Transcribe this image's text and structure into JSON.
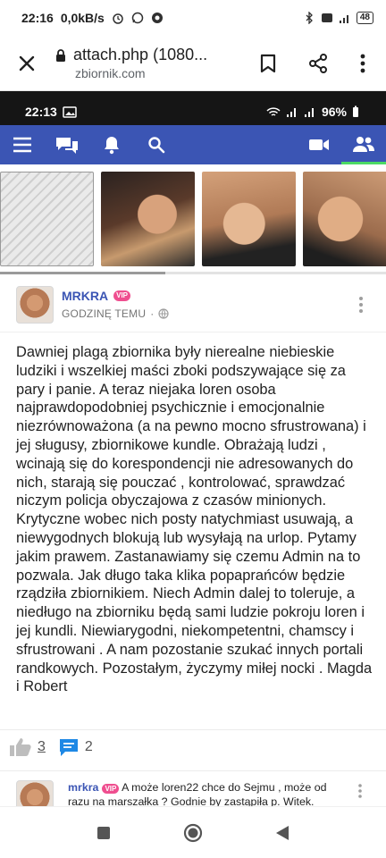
{
  "status_bar": {
    "time": "22:16",
    "speed": "0,0kB/s",
    "battery": "48"
  },
  "chrome": {
    "title": "attach.php (1080...",
    "domain": "zbiornik.com"
  },
  "inner_status": {
    "time": "22:13",
    "battery": "96%"
  },
  "post": {
    "author": "MRKRA",
    "vip_badge": "VIP",
    "time": "GODZINĘ TEMU",
    "separator": "·",
    "body": "Dawniej plagą zbiornika były nierealne niebieskie ludziki i wszelkiej maści zboki podszywające się za pary i panie. A teraz niejaka loren osoba najprawdopodobniej psychicznie i emocjonalnie niezrównoważona (a na pewno mocno sfrustrowana) i jej sługusy, zbiornikowe kundle. Obrażają ludzi , wcinają się do korespondencji nie adresowanych do nich, starają się pouczać , kontrolować, sprawdzać niczym policja obyczajowa z czasów minionych. Krytyczne wobec nich posty natychmiast usuwają, a niewygodnych blokują lub wysyłają na urlop. Pytamy jakim prawem. Zastanawiamy się czemu Admin na to pozwala. Jak długo taka klika popaprańców będzie rządziła zbiornikiem. Niech Admin dalej to toleruje, a niedługo na zbiorniku będą sami ludzie pokroju loren i jej kundli. Niewiarygodni, niekompetentni, chamscy i sfrustrowani . A nam pozostanie szukać innych portali randkowych. Pozostałym, życzymy miłej nocki . Magda i Robert",
    "likes": "3",
    "comments": "2"
  },
  "comment": {
    "author": "mrkra",
    "vip_badge": "VIP",
    "text": "A może loren22 chce do Sejmu , może od razu na marszałka ? Godnie by zastąpiła p. Witek."
  },
  "colors": {
    "brand_blue": "#3b55b4",
    "vip_pink": "#ef4e8f",
    "active_green": "#4cd964"
  },
  "icons": [
    "menu-icon",
    "chat-bubbles-icon",
    "bell-icon",
    "search-icon",
    "video-camera-icon",
    "users-icon",
    "thumbs-up-icon",
    "comment-icon",
    "globe-icon"
  ]
}
